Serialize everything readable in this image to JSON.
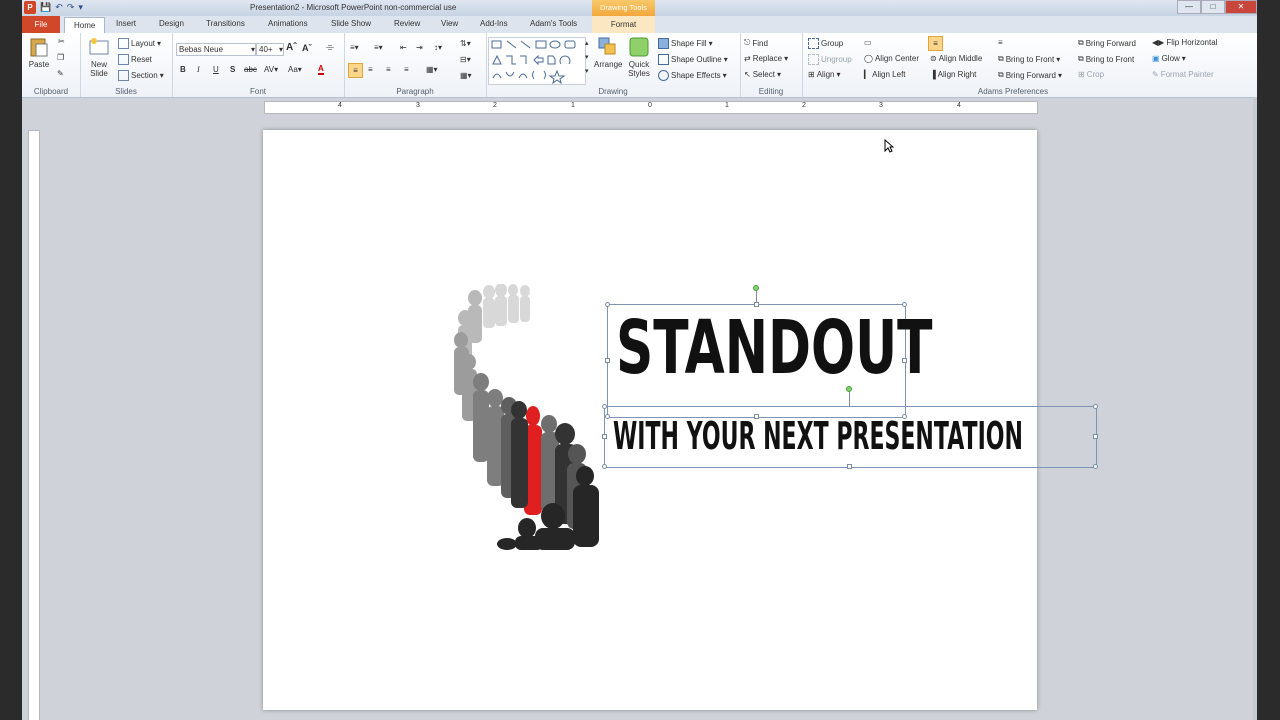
{
  "window": {
    "title": "Presentation2 - Microsoft PowerPoint non-commercial use",
    "contextual_group": "Drawing Tools"
  },
  "tabs": [
    "File",
    "Home",
    "Insert",
    "Design",
    "Transitions",
    "Animations",
    "Slide Show",
    "Review",
    "View",
    "Add-Ins",
    "Adam's Tools",
    "Format"
  ],
  "ribbon": {
    "clipboard": {
      "label": "Clipboard",
      "paste": "Paste"
    },
    "slides": {
      "label": "Slides",
      "new_slide": "New Slide",
      "layout": "Layout",
      "reset": "Reset",
      "section": "Section"
    },
    "font": {
      "label": "Font",
      "family": "Bebas Neue",
      "size": "40+"
    },
    "paragraph": {
      "label": "Paragraph"
    },
    "drawing": {
      "label": "Drawing",
      "arrange": "Arrange",
      "quick_styles": "Quick Styles",
      "shape_fill": "Shape Fill",
      "shape_outline": "Shape Outline",
      "shape_effects": "Shape Effects"
    },
    "editing": {
      "label": "Editing",
      "find": "Find",
      "replace": "Replace",
      "select": "Select"
    },
    "adams": {
      "label": "Adams Preferences",
      "group": "Group",
      "ungroup": "Ungroup",
      "align": "Align",
      "align_center": "Align Center",
      "align_left": "Align Left",
      "align_middle": "Align Middle",
      "align_right": "Align Right",
      "bring_to_front": "Bring to Front",
      "bring_forward": "Bring Forward",
      "bring_forward_2": "Bring Forward",
      "bring_to_front_2": "Bring to Front",
      "crop": "Crop",
      "flip_horizontal": "Flip Horizontal",
      "glow": "Glow",
      "format_painter": "Format Painter"
    }
  },
  "ruler": {
    "h_ticks": [
      "4",
      "3",
      "2",
      "1",
      "0",
      "1",
      "2",
      "3",
      "4"
    ]
  },
  "slide": {
    "title": "STANDOUT",
    "subtitle": "WITH YOUR NEXT PRESENTATION"
  },
  "colors": {
    "file_tab": "#d0472a",
    "contextual": "#f2a83a",
    "highlight_person": "#e02020"
  }
}
